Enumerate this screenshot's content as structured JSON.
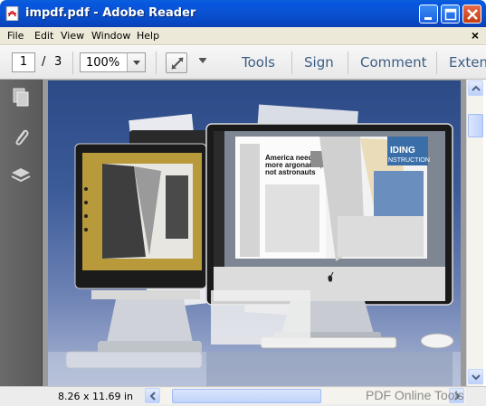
{
  "window": {
    "title": "impdf.pdf - Adobe Reader",
    "controls": [
      "minimize",
      "maximize",
      "close"
    ]
  },
  "menu": {
    "items": [
      {
        "label": "File",
        "mnemonic": "F"
      },
      {
        "label": "Edit",
        "mnemonic": "E"
      },
      {
        "label": "View",
        "mnemonic": "V"
      },
      {
        "label": "Window",
        "mnemonic": "W"
      },
      {
        "label": "Help",
        "mnemonic": "H"
      }
    ],
    "close_glyph": "×"
  },
  "toolbar": {
    "current_page": "1",
    "page_separator": "/",
    "total_pages": "3",
    "zoom": "100%",
    "links": [
      "Tools",
      "Sign",
      "Comment",
      "Extend"
    ]
  },
  "nav_pane": {
    "icons": [
      "page-thumbnails-icon",
      "attachments-icon",
      "layers-icon"
    ]
  },
  "document": {
    "magazine_headline": "America needs more argonauts, not astronauts",
    "magazine_right_heading": "IDING\nNSTRUCTION"
  },
  "status": {
    "page_size": "8.26 x 11.69 in"
  },
  "watermark": "PDF Online Tools",
  "colors": {
    "titlebar": "#0a52d0",
    "link": "#3b5e86",
    "nav_pane": "#5e5e5e",
    "page_bg": "#3a5a98"
  }
}
